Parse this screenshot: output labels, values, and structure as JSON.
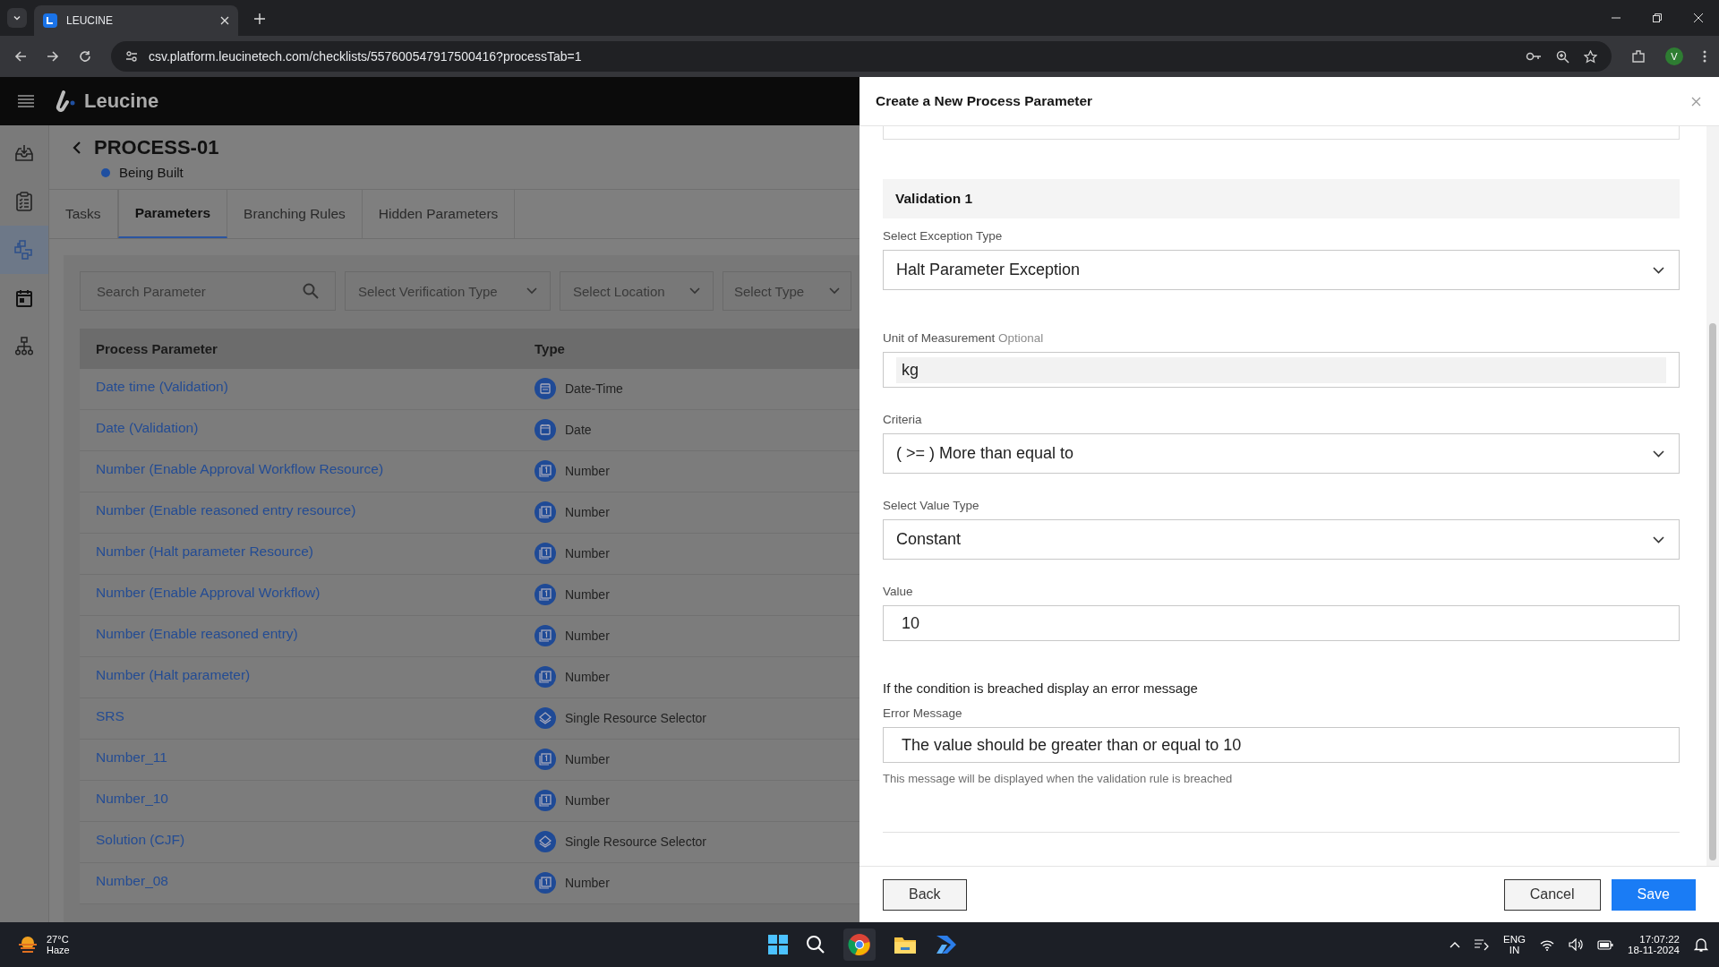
{
  "browser": {
    "tab_title": "LEUCINE",
    "url": "csv.platform.leucinetech.com/checklists/557600547917500416?processTab=1",
    "profile": "V"
  },
  "app": {
    "brand": "Leucine",
    "sidebar": [
      {
        "kind": "inbox",
        "selected": false
      },
      {
        "kind": "checklist",
        "selected": false
      },
      {
        "kind": "process",
        "selected": true
      },
      {
        "kind": "calendar",
        "selected": false
      },
      {
        "kind": "hierarchy",
        "selected": false
      }
    ],
    "page_title": "PROCESS-01",
    "status": "Being Built",
    "tabs": [
      {
        "label": "Tasks",
        "selected": false
      },
      {
        "label": "Parameters",
        "selected": true
      },
      {
        "label": "Branching Rules",
        "selected": false
      },
      {
        "label": "Hidden Parameters",
        "selected": false
      }
    ],
    "search": {
      "placeholder": "Search Parameter"
    },
    "filters": [
      "Select Verification Type",
      "Select Location",
      "Select Type"
    ],
    "table": {
      "columns": [
        "Process Parameter",
        "Type"
      ],
      "rows": [
        {
          "name": "Date time (Validation)",
          "type": "Date-Time",
          "kind": "datetime"
        },
        {
          "name": "Date (Validation)",
          "type": "Date",
          "kind": "date"
        },
        {
          "name": "Number (Enable Approval Workflow Resource)",
          "type": "Number",
          "kind": "number"
        },
        {
          "name": "Number (Enable reasoned entry resource)",
          "type": "Number",
          "kind": "number"
        },
        {
          "name": "Number (Halt parameter Resource)",
          "type": "Number",
          "kind": "number"
        },
        {
          "name": "Number (Enable Approval Workflow)",
          "type": "Number",
          "kind": "number"
        },
        {
          "name": "Number (Enable reasoned entry)",
          "type": "Number",
          "kind": "number"
        },
        {
          "name": "Number (Halt parameter)",
          "type": "Number",
          "kind": "number"
        },
        {
          "name": "SRS",
          "type": "Single Resource Selector",
          "kind": "resource"
        },
        {
          "name": "Number_11",
          "type": "Number",
          "kind": "number"
        },
        {
          "name": "Number_10",
          "type": "Number",
          "kind": "number"
        },
        {
          "name": "Solution (CJF)",
          "type": "Single Resource Selector",
          "kind": "resource"
        },
        {
          "name": "Number_08",
          "type": "Number",
          "kind": "number"
        }
      ]
    }
  },
  "modal": {
    "title": "Create a New Process Parameter",
    "section": "Validation 1",
    "fields": [
      {
        "kind": "select",
        "label": "Select Exception Type",
        "value": "Halt Parameter Exception"
      },
      {
        "kind": "input",
        "label": "Unit of Measurement",
        "optional": "Optional",
        "value": "kg"
      },
      {
        "kind": "select",
        "label": "Criteria",
        "value": "( >= ) More than equal to"
      },
      {
        "kind": "select",
        "label": "Select Value Type",
        "value": "Constant"
      },
      {
        "kind": "input",
        "label": "Value",
        "value": "10"
      }
    ],
    "note": "If the condition is breached display an error message",
    "error_field": {
      "label": "Error Message",
      "value": "The value should be greater than or equal to 10",
      "helper": "This message will be displayed when the validation rule is breached"
    },
    "buttons": {
      "back": "Back",
      "cancel": "Cancel",
      "save": "Save"
    }
  },
  "taskbar": {
    "temperature": "27°C",
    "weather": "Haze",
    "language": "ENG",
    "region": "IN",
    "time": "17:07:22",
    "date": "18-11-2024"
  }
}
